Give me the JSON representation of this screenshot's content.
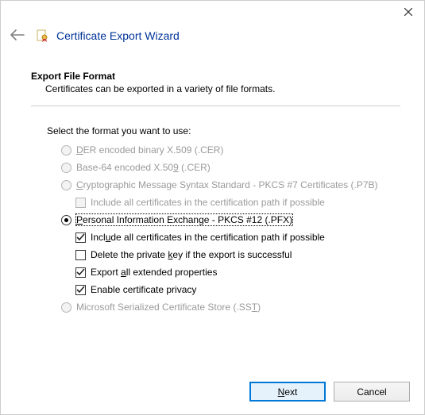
{
  "titlebar": {
    "close_tooltip": "Close"
  },
  "wizard_title": "Certificate Export Wizard",
  "heading": "Export File Format",
  "subheading": "Certificates can be exported in a variety of file formats.",
  "instruction": "Select the format you want to use:",
  "format_options": {
    "der": {
      "pre": "",
      "ak": "D",
      "post": "ER encoded binary X.509 (.CER)",
      "enabled": false,
      "selected": false
    },
    "base64": {
      "pre": "Base-64 encoded X.50",
      "ak": "9",
      "post": " (.CER)",
      "enabled": false,
      "selected": false
    },
    "p7b": {
      "pre": "",
      "ak": "C",
      "post": "ryptographic Message Syntax Standard - PKCS #7 Certificates (.P7B)",
      "enabled": false,
      "selected": false
    },
    "p7b_include": {
      "label": "Include all certificates in the certification path if possible",
      "enabled": false,
      "checked": false
    },
    "pfx": {
      "pre": "",
      "ak": "P",
      "post": "ersonal Information Exchange - PKCS #12 (.PFX)",
      "enabled": true,
      "selected": true
    },
    "pfx_include": {
      "pre": "Incl",
      "ak": "u",
      "post": "de all certificates in the certification path if possible",
      "checked": true
    },
    "pfx_deletekey": {
      "pre": "Delete the private ",
      "ak": "k",
      "post": "ey if the export is successful",
      "checked": false
    },
    "pfx_extprops": {
      "pre": "Export ",
      "ak": "a",
      "post": "ll extended properties",
      "checked": true
    },
    "pfx_privacy": {
      "label": "Enable certificate privacy",
      "checked": true
    },
    "sst": {
      "pre": "Microsoft Serialized Certificate Store (.SS",
      "ak": "T",
      "post": ")",
      "enabled": false,
      "selected": false
    }
  },
  "buttons": {
    "next_pre": "",
    "next_ak": "N",
    "next_post": "ext",
    "cancel": "Cancel"
  }
}
